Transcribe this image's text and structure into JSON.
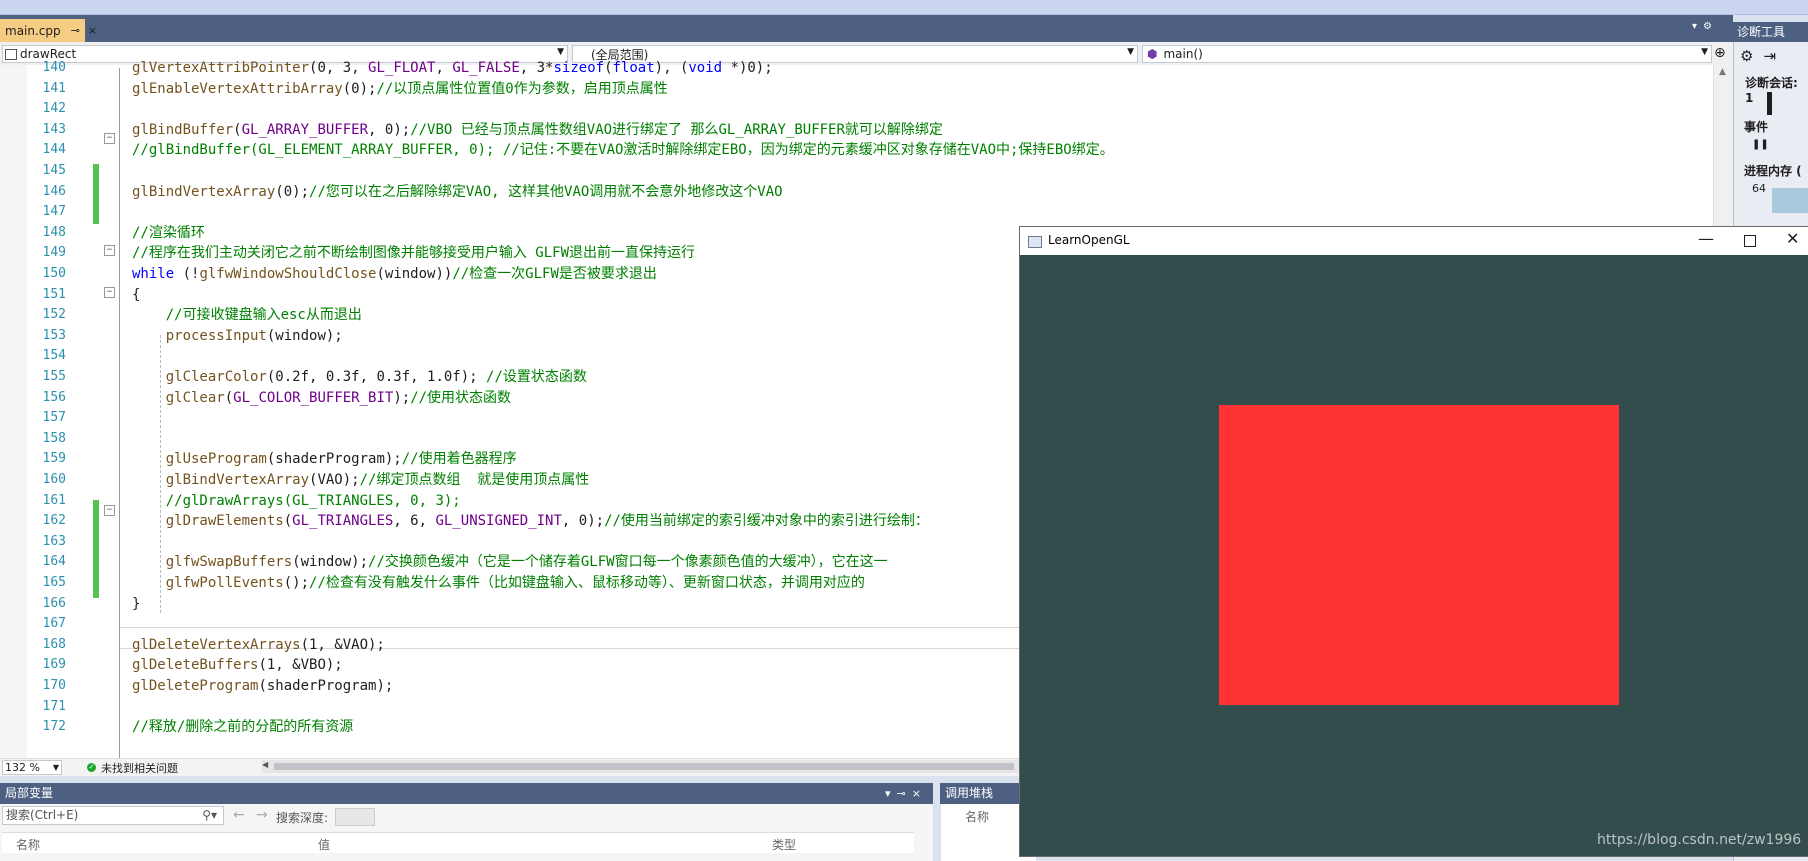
{
  "tab": {
    "label": "main.cpp",
    "pin": "⊸",
    "close": "×"
  },
  "nav": {
    "scope_combo": "drawRect",
    "global_combo": "(全局范围)",
    "function_combo": "main()"
  },
  "code_lines": [
    {
      "num": "140",
      "html": "    <span class=\"fn\">glVertexAttribPointer</span>(0, 3, <span class=\"mac\">GL_FLOAT</span>, <span class=\"mac\">GL_FALSE</span>, 3*<span class=\"kw\">sizeof</span>(<span class=\"kw\">float</span>), (<span class=\"kw\">void</span> *)0);"
    },
    {
      "num": "141",
      "html": "    <span class=\"fn\">glEnableVertexAttribArray</span>(0);<span class=\"cmt\">//以顶点属性位置值0作为参数，启用顶点属性</span>"
    },
    {
      "num": "142",
      "html": ""
    },
    {
      "num": "143",
      "html": "    <span class=\"fn\">glBindBuffer</span>(<span class=\"mac\">GL_ARRAY_BUFFER</span>, 0);<span class=\"cmt\">//VBO 已经与顶点属性数组VAO进行绑定了 那么GL_ARRAY_BUFFER就可以解除绑定</span>"
    },
    {
      "num": "144",
      "html": "    <span class=\"cmt\">//glBindBuffer(GL_ELEMENT_ARRAY_BUFFER, 0); //记住:不要在VAO激活时解除绑定EBO，因为绑定的元素缓冲区对象存储在VAO中;保持EBO绑定。</span>"
    },
    {
      "num": "145",
      "html": ""
    },
    {
      "num": "146",
      "html": "    <span class=\"fn\">glBindVertexArray</span>(0);<span class=\"cmt\">//您可以在之后解除绑定VAO, 这样其他VAO调用就不会意外地修改这个VAO</span>"
    },
    {
      "num": "147",
      "html": ""
    },
    {
      "num": "148",
      "html": "    <span class=\"cmt\">//渲染循环</span>"
    },
    {
      "num": "149",
      "html": "    <span class=\"cmt\">//程序在我们主动关闭它之前不断绘制图像并能够接受用户输入 GLFW退出前一直保持运行</span>"
    },
    {
      "num": "150",
      "html": "    <span class=\"kw\">while</span> (!<span class=\"fn\">glfwWindowShouldClose</span>(window))<span class=\"cmt\">//检查一次GLFW是否被要求退出</span>"
    },
    {
      "num": "151",
      "html": "    {"
    },
    {
      "num": "152",
      "html": "        <span class=\"cmt\">//可接收键盘输入esc从而退出</span>"
    },
    {
      "num": "153",
      "html": "        <span class=\"fn\">processInput</span>(window);"
    },
    {
      "num": "154",
      "html": ""
    },
    {
      "num": "155",
      "html": "        <span class=\"fn\">glClearColor</span>(0.2f, 0.3f, 0.3f, 1.0f); <span class=\"cmt\">//设置状态函数</span>"
    },
    {
      "num": "156",
      "html": "        <span class=\"fn\">glClear</span>(<span class=\"mac\">GL_COLOR_BUFFER_BIT</span>);<span class=\"cmt\">//使用状态函数</span>"
    },
    {
      "num": "157",
      "html": ""
    },
    {
      "num": "158",
      "html": ""
    },
    {
      "num": "159",
      "html": "        <span class=\"fn\">glUseProgram</span>(shaderProgram);<span class=\"cmt\">//使用着色器程序</span>"
    },
    {
      "num": "160",
      "html": "        <span class=\"fn\">glBindVertexArray</span>(VAO);<span class=\"cmt\">//绑定顶点数组  就是使用顶点属性</span>"
    },
    {
      "num": "161",
      "html": "        <span class=\"cmt\">//glDrawArrays(GL_TRIANGLES, 0, 3);</span>"
    },
    {
      "num": "162",
      "html": "        <span class=\"fn\">glDrawElements</span>(<span class=\"mac\">GL_TRIANGLES</span>, 6, <span class=\"mac\">GL_UNSIGNED_INT</span>, 0);<span class=\"cmt\">//使用当前绑定的索引缓冲对象中的索引进行绘制：</span>"
    },
    {
      "num": "163",
      "html": ""
    },
    {
      "num": "164",
      "html": "        <span class=\"fn\">glfwSwapBuffers</span>(window);<span class=\"cmt\">//交换颜色缓冲（它是一个储存着GLFW窗口每一个像素颜色值的大缓冲），它在这一</span>"
    },
    {
      "num": "165",
      "html": "        <span class=\"fn\">glfwPollEvents</span>();<span class=\"cmt\">//检查有没有触发什么事件（比如键盘输入、鼠标移动等）、更新窗口状态，并调用对应的</span>"
    },
    {
      "num": "166",
      "html": "    }"
    },
    {
      "num": "167",
      "html": ""
    },
    {
      "num": "168",
      "html": "    <span class=\"fn\">glDeleteVertexArrays</span>(1, &amp;VAO);"
    },
    {
      "num": "169",
      "html": "    <span class=\"fn\">glDeleteBuffers</span>(1, &amp;VBO);"
    },
    {
      "num": "170",
      "html": "    <span class=\"fn\">glDeleteProgram</span>(shaderProgram);"
    },
    {
      "num": "171",
      "html": ""
    },
    {
      "num": "172",
      "html": "    <span class=\"cmt\">//释放/删除之前的分配的所有资源</span>"
    }
  ],
  "status": {
    "zoom": "132 %",
    "issues": "未找到相关问题"
  },
  "locals": {
    "title": "局部变量",
    "search_placeholder": "搜索(Ctrl+E)",
    "depth_label": "搜索深度:",
    "col_name": "名称",
    "col_value": "值",
    "col_type": "类型"
  },
  "callstack": {
    "title": "调用堆栈",
    "col_name": "名称"
  },
  "diag": {
    "title": "诊断工具",
    "session": "诊断会话: 1",
    "events": "事件",
    "memory": "进程内存 (",
    "mem_value": "64"
  },
  "glwindow": {
    "title": "LearnOpenGL",
    "clear_color": "#334d4d",
    "rect_color": "#ff3333"
  },
  "watermark": "https://blog.csdn.net/zw1996"
}
